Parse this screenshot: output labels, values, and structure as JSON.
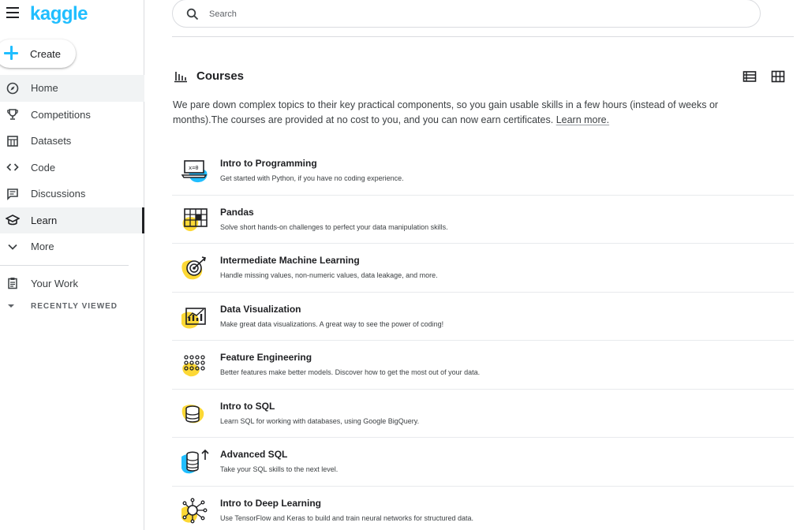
{
  "brand": {
    "name": "kaggle",
    "color": "#20beff"
  },
  "colors": {
    "accent_yellow": "#fdd835",
    "accent_blue": "#20beff",
    "text": "#202124",
    "muted": "#5f6368"
  },
  "sidebar": {
    "create_label": "Create",
    "items": [
      {
        "label": "Home",
        "icon": "compass-icon"
      },
      {
        "label": "Competitions",
        "icon": "trophy-icon"
      },
      {
        "label": "Datasets",
        "icon": "table-icon"
      },
      {
        "label": "Code",
        "icon": "code-icon"
      },
      {
        "label": "Discussions",
        "icon": "comment-icon"
      },
      {
        "label": "Learn",
        "icon": "school-icon"
      },
      {
        "label": "More",
        "icon": "chevron-down-icon"
      }
    ],
    "your_work_label": "Your Work",
    "recently_viewed_label": "RECENTLY VIEWED"
  },
  "search": {
    "placeholder": "Search"
  },
  "main": {
    "title": "Courses",
    "intro_text": "We pare down complex topics to their key practical components, so you gain usable skills in a few hours (instead of weeks or months).The courses are provided at no cost to you, and you can now earn certificates. ",
    "learn_more": "Learn more.",
    "courses": [
      {
        "name": "Intro to Programming",
        "desc": "Get started with Python, if you have no coding experience.",
        "icon": "laptop-icon"
      },
      {
        "name": "Pandas",
        "desc": "Solve short hands-on challenges to perfect your data manipulation skills.",
        "icon": "grid-icon"
      },
      {
        "name": "Intermediate Machine Learning",
        "desc": "Handle missing values, non-numeric values, data leakage, and more.",
        "icon": "target-icon"
      },
      {
        "name": "Data Visualization",
        "desc": "Make great data visualizations. A great way to see the power of coding!",
        "icon": "chart-icon"
      },
      {
        "name": "Feature Engineering",
        "desc": "Better features make better models. Discover how to get the most out of your data.",
        "icon": "dots-icon"
      },
      {
        "name": "Intro to SQL",
        "desc": "Learn SQL for working with databases, using Google BigQuery.",
        "icon": "database-icon"
      },
      {
        "name": "Advanced SQL",
        "desc": "Take your SQL skills to the next level.",
        "icon": "database-up-icon"
      },
      {
        "name": "Intro to Deep Learning",
        "desc": "Use TensorFlow and Keras to build and train neural networks for structured data.",
        "icon": "neural-network-icon"
      }
    ]
  }
}
